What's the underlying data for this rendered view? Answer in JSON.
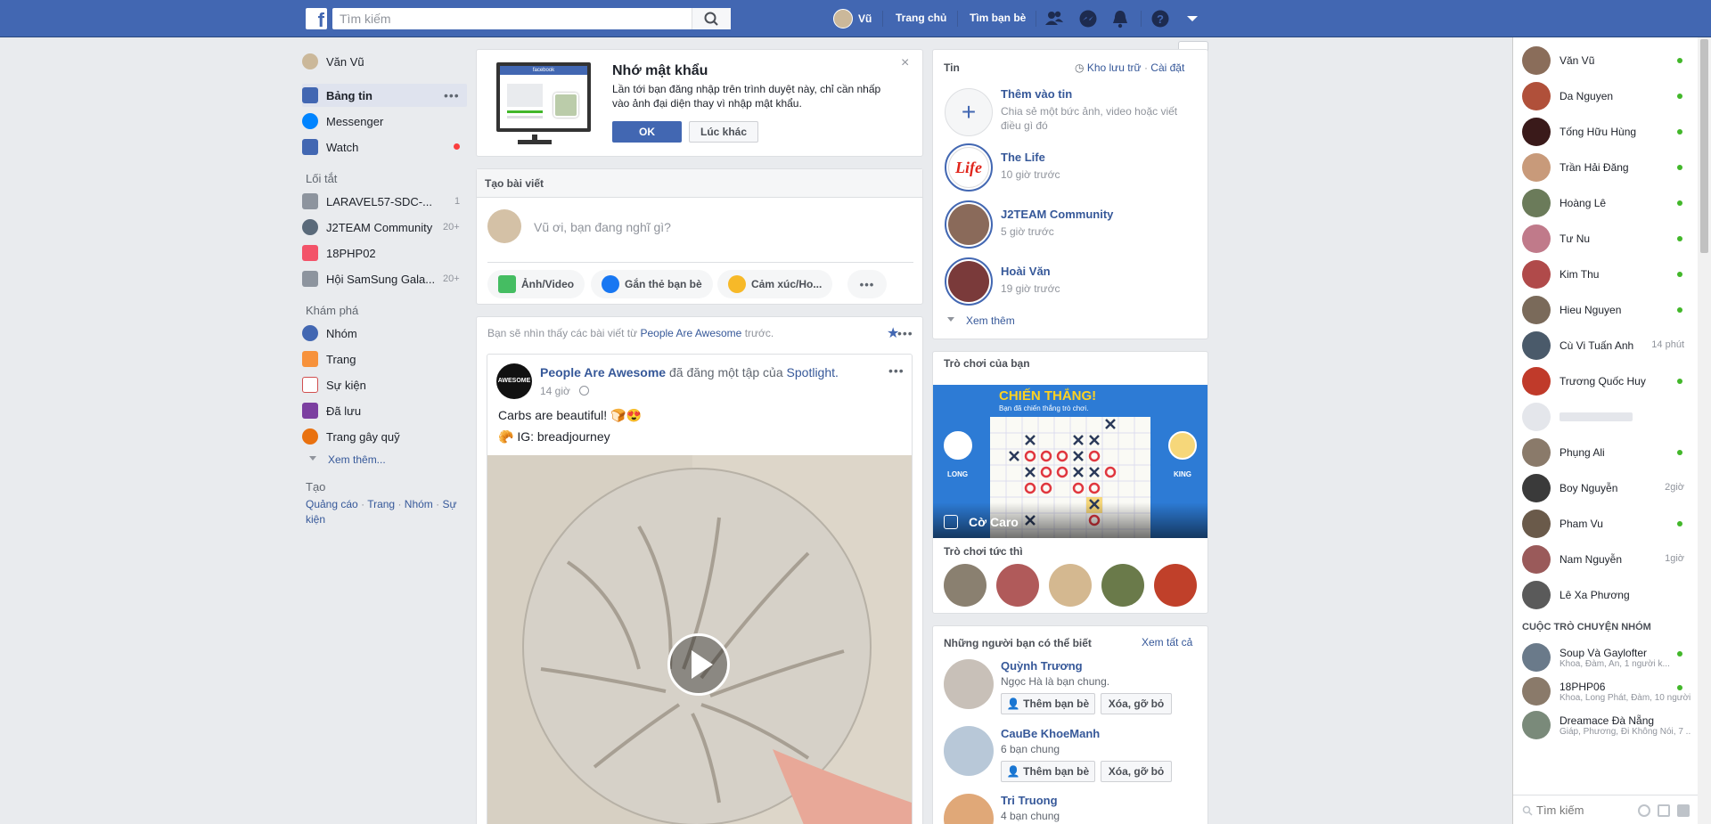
{
  "topbar": {
    "logo": "f",
    "search_placeholder": "Tìm kiếm",
    "user_name": "Vũ",
    "home": "Trang chủ",
    "find_friends": "Tìm bạn bè"
  },
  "left_nav": {
    "profile": "Văn Vũ",
    "items": [
      {
        "label": "Bảng tin",
        "icon": "news-feed-icon"
      },
      {
        "label": "Messenger",
        "icon": "messenger-icon"
      },
      {
        "label": "Watch",
        "icon": "watch-icon"
      }
    ],
    "shortcuts_title": "Lối tắt",
    "shortcuts": [
      {
        "label": "LARAVEL57-SDC-...",
        "count": "1"
      },
      {
        "label": "J2TEAM Community",
        "count": "20+"
      },
      {
        "label": "18PHP02",
        "count": ""
      },
      {
        "label": "Hội SamSung Gala...",
        "count": "20+"
      }
    ],
    "explore_title": "Khám phá",
    "explore": [
      {
        "label": "Nhóm"
      },
      {
        "label": "Trang"
      },
      {
        "label": "Sự kiện"
      },
      {
        "label": "Đã lưu"
      },
      {
        "label": "Trang gây quỹ"
      }
    ],
    "see_more": "Xem thêm...",
    "create_title": "Tạo",
    "create_links": [
      "Quảng cáo",
      "Trang",
      "Nhóm",
      "Sự kiện"
    ],
    "create_sep": "·"
  },
  "remember_password": {
    "title": "Nhớ mật khẩu",
    "body": "Lần tới bạn đăng nhập trên trình duyệt này, chỉ cần nhấp vào ảnh đại diện thay vì nhập mật khẩu.",
    "ok": "OK",
    "later": "Lúc khác",
    "mock_brand": "facebook"
  },
  "composer": {
    "title": "Tạo bài viết",
    "placeholder": "Vũ ơi, bạn đang nghĩ gì?",
    "actions": [
      "Ảnh/Video",
      "Gắn thẻ bạn bè",
      "Cảm xúc/Ho..."
    ]
  },
  "post": {
    "notice_pre": "Bạn sẽ nhìn thấy các bài viết từ",
    "notice_page": "People Are Awesome",
    "notice_post": "trước.",
    "author": "People Are Awesome",
    "action": "đã đăng một tập của",
    "target": "Spotlight.",
    "time": "14 giờ",
    "text": "Carbs are beautiful! 🍞😍",
    "ig": "IG: breadjourney",
    "avatar_text": "AWESOME"
  },
  "stories": {
    "title": "Tin",
    "archive": "Kho lưu trữ",
    "settings": "Cài đặt",
    "add_title": "Thêm vào tin",
    "add_desc": "Chia sẻ một bức ảnh, video hoặc viết điều gì đó",
    "items": [
      {
        "name": "The Life",
        "time": "10 giờ trước",
        "logo": "Life"
      },
      {
        "name": "J2TEAM Community",
        "time": "5 giờ trước"
      },
      {
        "name": "Hoài Văn",
        "time": "19 giờ trước"
      }
    ],
    "see_more": "Xem thêm"
  },
  "games": {
    "title": "Trò chơi của bạn",
    "banner_title": "CHIẾN THẮNG!",
    "banner_sub": "Bạn đã chiến thắng trò chơi.",
    "player_left": "LONG",
    "player_right": "KING",
    "game_name": "Cờ Caro",
    "instant_title": "Trò chơi tức thì"
  },
  "pymk": {
    "title": "Những người bạn có thể biết",
    "see_all": "Xem tất cả",
    "add": "Thêm bạn bè",
    "remove": "Xóa, gỡ bỏ",
    "people": [
      {
        "name": "Quỳnh Trương",
        "info": "Ngọc Hà là bạn chung."
      },
      {
        "name": "CauBe KhoeManh",
        "info": "6 bạn chung"
      },
      {
        "name": "Tri Truong",
        "info": "4 bạn chung"
      }
    ]
  },
  "chat": {
    "contacts": [
      {
        "name": "Văn Vũ",
        "status": "online",
        "color": "#8a6d5a"
      },
      {
        "name": "Da Nguyen",
        "status": "online",
        "color": "#b0503a"
      },
      {
        "name": "Tống Hữu Hùng",
        "status": "online",
        "color": "#3a1a1a"
      },
      {
        "name": "Trần Hải Đăng",
        "status": "online",
        "color": "#c89a7a"
      },
      {
        "name": "Hoàng Lê",
        "status": "online",
        "color": "#6b7b5a"
      },
      {
        "name": "Tư Nu",
        "status": "online",
        "color": "#c07a8a"
      },
      {
        "name": "Kim Thu",
        "status": "online",
        "color": "#b04a4a"
      },
      {
        "name": "Hieu Nguyen",
        "status": "online",
        "color": "#7a6a5a"
      },
      {
        "name": "Cù Vi Tuấn Anh",
        "status": "14 phút",
        "color": "#4a5a6a"
      },
      {
        "name": "Trương Quốc Huy",
        "status": "online",
        "color": "#c03a2a"
      },
      {
        "name": "",
        "status": "",
        "color": "#e4e6eb"
      },
      {
        "name": "Phụng Ali",
        "status": "online",
        "color": "#8a7a6a"
      },
      {
        "name": "Boy Nguyễn",
        "status": "2giờ",
        "color": "#3a3a3a"
      },
      {
        "name": "Pham Vu",
        "status": "online",
        "color": "#6a5a4a"
      },
      {
        "name": "Nam Nguyễn",
        "status": "1giờ",
        "color": "#9a5a5a"
      },
      {
        "name": "Lê Xa Phương",
        "status": "",
        "color": "#5a5a5a"
      }
    ],
    "group_title": "CUỘC TRÒ CHUYỆN NHÓM",
    "groups": [
      {
        "name": "Soup Và Gaylofter",
        "members": "Khoa, Đàm, An, 1 người k...",
        "status": "online"
      },
      {
        "name": "18PHP06",
        "members": "Khoa, Long Phát, Đàm, 10 người...",
        "status": "online"
      },
      {
        "name": "Dreamace Đà Nẵng",
        "members": "Giáp, Phương, Đi Không Nói, 7 ...",
        "status": ""
      }
    ],
    "search_placeholder": "Tìm kiếm"
  },
  "colors": {
    "brand": "#4267b2",
    "online": "#42b72a",
    "link": "#365899",
    "notification": "#fa3e3e"
  }
}
